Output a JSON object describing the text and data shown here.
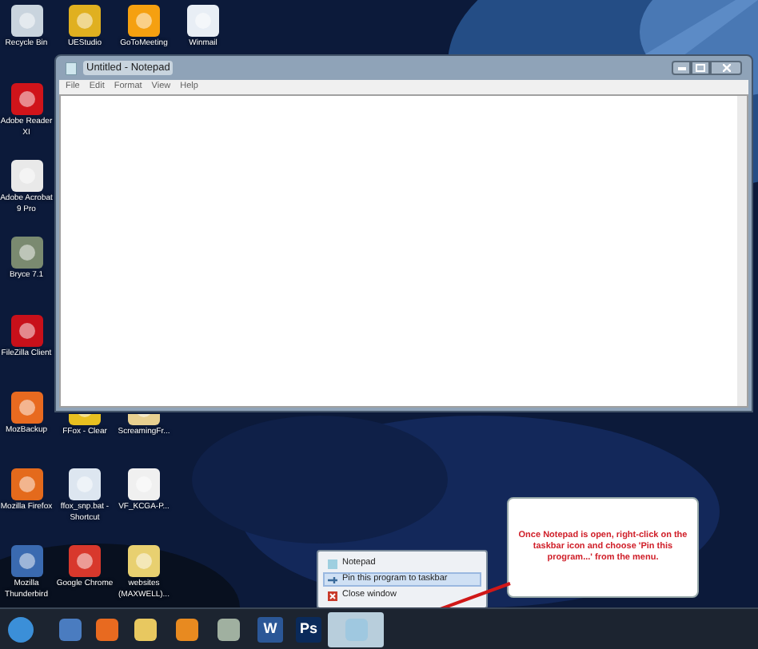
{
  "desktop_icons": [
    {
      "label": "Recycle Bin"
    },
    {
      "label": "UEStudio"
    },
    {
      "label": "GoToMeeting"
    },
    {
      "label": "Winmail"
    },
    {
      "label": "Adobe Reader XI"
    },
    {
      "label": "Adobe Acrobat 9 Pro"
    },
    {
      "label": "Bryce 7.1"
    },
    {
      "label": "FileZilla Client"
    },
    {
      "label": "MozBackup"
    },
    {
      "label": "FFox - Clear"
    },
    {
      "label": "ScreamingFr..."
    },
    {
      "label": "Mozilla Firefox"
    },
    {
      "label": "ffox_snp.bat - Shortcut"
    },
    {
      "label": "VF_KCGA-P..."
    },
    {
      "label": "Mozilla Thunderbird"
    },
    {
      "label": "Google Chrome"
    },
    {
      "label": "websites (MAXWELL)..."
    }
  ],
  "window": {
    "title": "Untitled - Notepad",
    "menu": [
      "File",
      "Edit",
      "Format",
      "View",
      "Help"
    ]
  },
  "jump_list": {
    "items": [
      {
        "label": "Notepad",
        "selected": false
      },
      {
        "label": "Pin this program to taskbar",
        "selected": true
      },
      {
        "label": "Close window",
        "selected": false
      }
    ]
  },
  "callout": {
    "text": "Once Notepad is open, right-click on the taskbar icon and choose 'Pin this program...' from the menu."
  },
  "taskbar": {
    "items": [
      {
        "active": false
      },
      {
        "active": false
      },
      {
        "active": false
      },
      {
        "active": false
      },
      {
        "active": false
      },
      {
        "active": false
      },
      {
        "label": "W",
        "active": false
      },
      {
        "label": "Ps",
        "active": false
      },
      {
        "active": true
      }
    ]
  }
}
